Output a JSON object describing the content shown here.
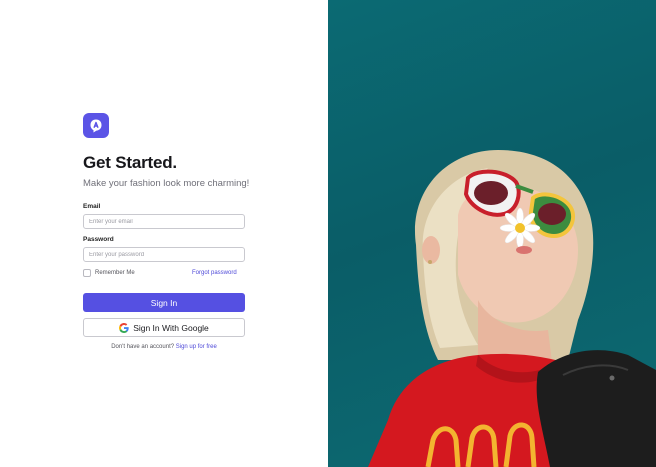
{
  "brand": {
    "logo_icon": "app-logo-icon",
    "accent": "#5550e2"
  },
  "heading": {
    "title": "Get Started.",
    "subtitle": "Make your fashion look more charming!"
  },
  "form": {
    "email_label": "Email",
    "email_placeholder": "Enter your email",
    "password_label": "Password",
    "password_placeholder": "Enter your password",
    "remember_label": "Remember Me",
    "forgot_label": "Forgot password",
    "signin_label": "Sign In",
    "google_label": "Sign In With Google",
    "google_icon": "google-icon"
  },
  "footer": {
    "prompt": "Don't have an account?",
    "signup_link": "Sign up for free"
  },
  "hero": {
    "description_icon": "hero-photo"
  }
}
